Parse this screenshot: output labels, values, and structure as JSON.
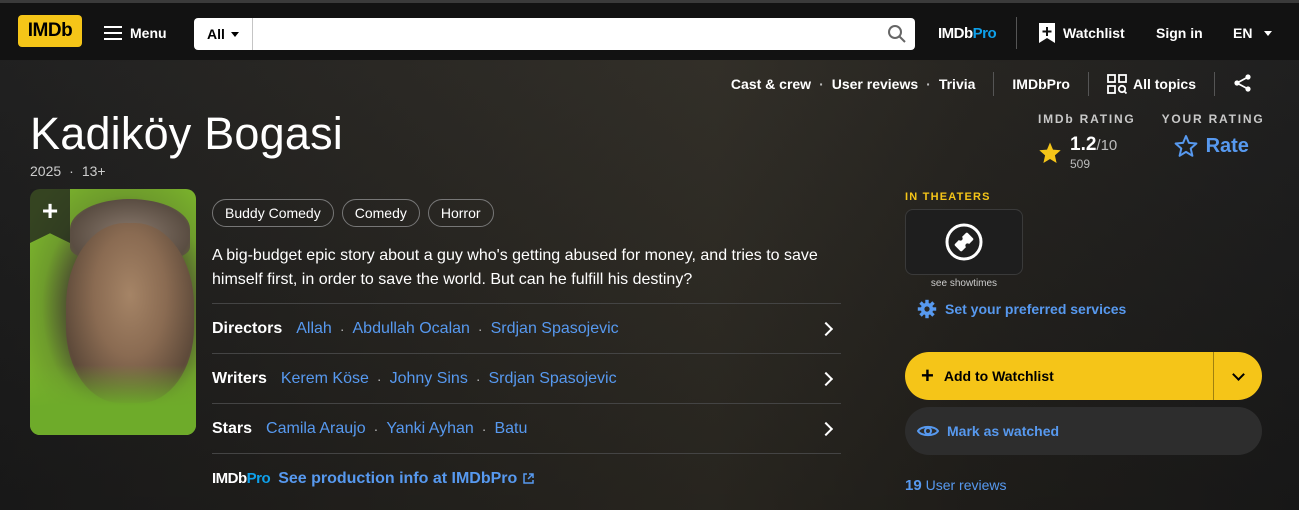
{
  "nav": {
    "logo": "IMDb",
    "menu_label": "Menu",
    "search_category": "All",
    "search_placeholder": "",
    "imdbpro_prefix": "IMDb",
    "imdbpro_suffix": "Pro",
    "watchlist_label": "Watchlist",
    "signin_label": "Sign in",
    "language": "EN"
  },
  "subnav": {
    "items": [
      "Cast & crew",
      "User reviews",
      "Trivia"
    ],
    "imdbpro": "IMDbPro",
    "all_topics": "All topics"
  },
  "title": {
    "name": "Kadiköy Bogasi",
    "year": "2025",
    "certificate": "13+"
  },
  "ratings": {
    "imdb_label": "IMDb RATING",
    "score": "1.2",
    "out_of": "/10",
    "votes": "509",
    "your_label": "YOUR RATING",
    "rate_label": "Rate"
  },
  "genres": [
    "Buddy Comedy",
    "Comedy",
    "Horror"
  ],
  "plot": "A big-budget epic story about a guy who's getting abused for money, and tries to save himself first, in order to save the world. But can he fulfill his destiny?",
  "credits": [
    {
      "label": "Directors",
      "names": [
        "Allah",
        "Abdullah Ocalan",
        "Srdjan Spasojevic"
      ]
    },
    {
      "label": "Writers",
      "names": [
        "Kerem Köse",
        "Johny Sins",
        "Srdjan Spasojevic"
      ]
    },
    {
      "label": "Stars",
      "names": [
        "Camila Araujo",
        "Yanki Ayhan",
        "Batu"
      ]
    }
  ],
  "production": {
    "pro_prefix": "IMDb",
    "pro_suffix": "Pro",
    "link": "See production info at IMDbPro"
  },
  "sidebar": {
    "in_theaters": "IN THEATERS",
    "showtimes": "see showtimes",
    "preferred_services": "Set your preferred services",
    "add_watchlist": "Add to Watchlist",
    "mark_watched": "Mark as watched",
    "review_count": "19",
    "reviews_label": "User reviews"
  },
  "colors": {
    "brand_yellow": "#f5c518",
    "link_blue": "#5799ef",
    "pro_blue": "#0ea0ea",
    "nav_bg": "#121212"
  },
  "icons": [
    "hamburger-icon",
    "search-icon",
    "watchlist-add-icon",
    "caret-down-icon",
    "grid-icon",
    "share-icon",
    "star-icon",
    "star-outline-icon",
    "ticket-icon",
    "gear-icon",
    "eye-icon",
    "external-link-icon",
    "chevron-right-icon",
    "chevron-down-icon",
    "plus-icon"
  ]
}
